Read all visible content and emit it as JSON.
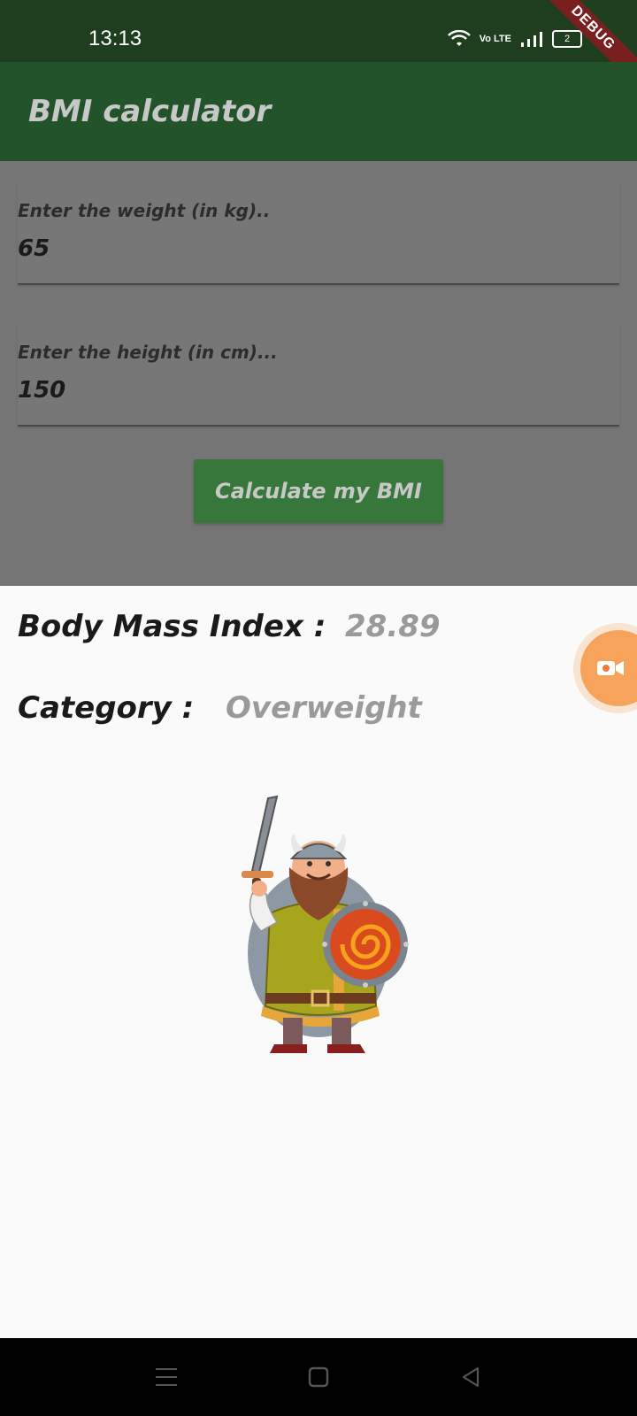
{
  "status_bar": {
    "time": "13:13",
    "network": "Vo LTE",
    "battery": "2",
    "debug_banner": "DEBUG"
  },
  "app_bar": {
    "title": "BMI calculator"
  },
  "form": {
    "weight": {
      "label": "Enter the weight (in kg)..",
      "value": "65"
    },
    "height": {
      "label": "Enter the height (in cm)...",
      "value": "150"
    },
    "calculate_button": "Calculate my BMI"
  },
  "result": {
    "bmi_label": "Body Mass Index :",
    "bmi_value": "28.89",
    "category_label": "Category :",
    "category_value": "Overweight",
    "illustration": "viking-warrior-illustration"
  },
  "nav_bar": {
    "icons": [
      "menu-icon",
      "home-icon",
      "back-icon"
    ]
  },
  "colors": {
    "status_bar": "#1f3d1f",
    "app_bar": "#23532a",
    "button": "#37773b",
    "scrim": "#757575",
    "sheet": "#fafafa"
  }
}
